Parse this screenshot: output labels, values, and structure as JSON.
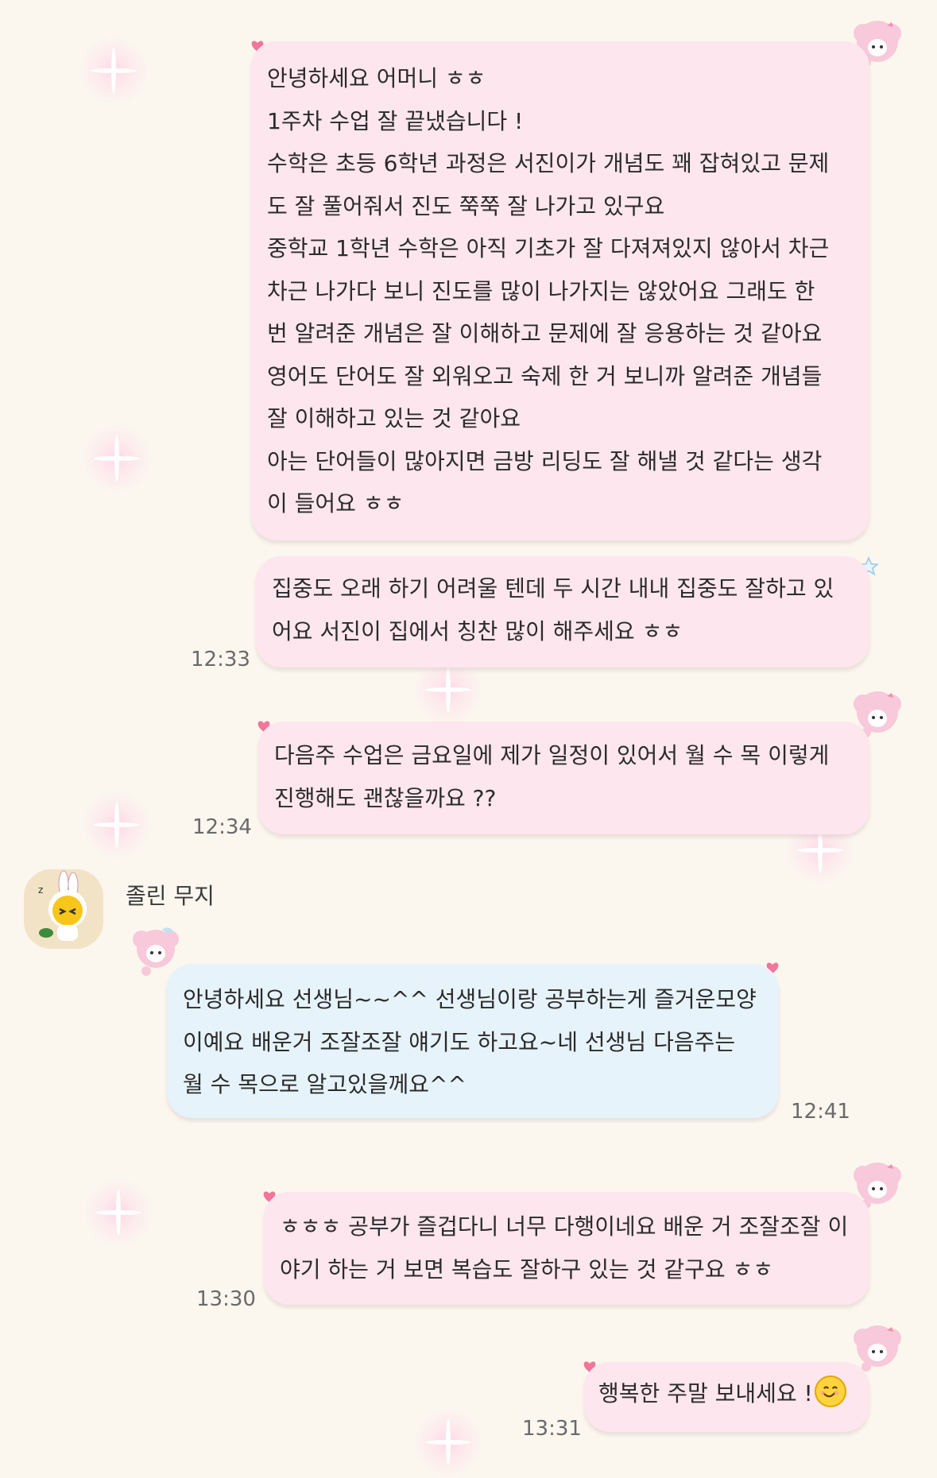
{
  "messages": [
    {
      "id": "msg1",
      "sender": "me",
      "lines": [
        "안녕하세요 어머니 ㅎㅎ",
        "1주차 수업 잘 끝냈습니다 !",
        "수학은 초등 6학년 과정은 서진이가 개념도 꽤 잡혀있고 문제",
        "도 잘 풀어줘서 진도 쭉쭉 잘 나가고 있구요",
        "중학교 1학년 수학은 아직 기초가 잘 다져져있지 않아서 차근",
        "차근 나가다 보니 진도를 많이 나가지는 않았어요 그래도 한",
        "번 알려준 개념은 잘 이해하고 문제에 잘 응용하는 것 같아요",
        "영어도 단어도 잘 외워오고 숙제 한 거 보니까 알려준 개념들",
        "잘 이해하고 있는 것 같아요",
        "아는 단어들이 많아지면 금방 리딩도 잘 해낼 것 같다는 생각",
        "이 들어요 ㅎㅎ"
      ],
      "time": ""
    },
    {
      "id": "msg2",
      "sender": "me",
      "lines": [
        "집중도 오래 하기 어려울 텐데 두 시간 내내 집중도 잘하고 있",
        "어요 서진이 집에서 칭찬 많이 해주세요 ㅎㅎ"
      ],
      "time": "12:33"
    },
    {
      "id": "msg3",
      "sender": "me",
      "lines": [
        "다음주 수업은 금요일에 제가 일정이 있어서 월 수 목 이렇게",
        "진행해도 괜찮을까요 ??"
      ],
      "time": "12:34"
    },
    {
      "id": "msg4",
      "sender": "them",
      "name": "졸린 무지",
      "lines": [
        "안녕하세요 선생님~~^^ 선생님이랑 공부하는게 즐거운모양",
        "이예요 배운거 조잘조잘 얘기도 하고요~네 선생님 다음주는",
        "월 수 목으로 알고있을께요^^"
      ],
      "time": "12:41"
    },
    {
      "id": "msg5",
      "sender": "me",
      "lines": [
        "ㅎㅎㅎ 공부가 즐겁다니 너무 다행이네요 배운 거 조잘조잘 이",
        "야기 하는 거 보면 복습도 잘하구 있는 것 같구요 ㅎㅎ"
      ],
      "time": "13:30"
    },
    {
      "id": "msg6",
      "sender": "me",
      "lines": [
        "행복한 주말 보내세요 !"
      ],
      "emoji": "smiling-face-emoji",
      "time": "13:31"
    }
  ],
  "colors": {
    "background": "#fbf7ef",
    "my_bubble": "#fde6ee",
    "their_bubble": "#e7f3fb",
    "heart": "#f2759a"
  }
}
